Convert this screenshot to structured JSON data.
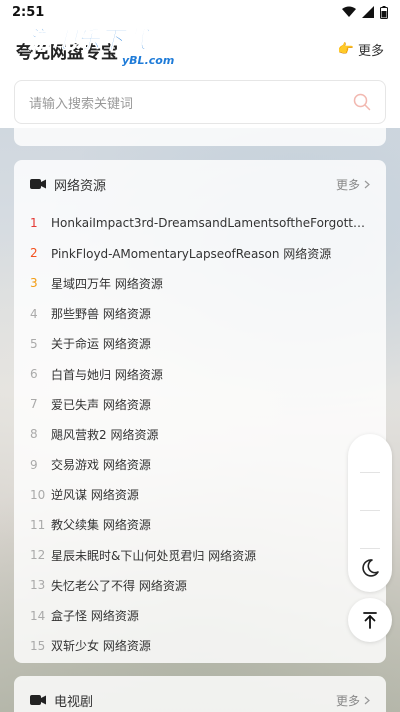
{
  "status_bar": {
    "time": "2:51"
  },
  "header": {
    "title": "夸克网盘专宝",
    "watermark": {
      "main": "游吧乐下载",
      "sub": "yBL.com"
    },
    "more_label": "更多",
    "more_emoji": "👉"
  },
  "search": {
    "placeholder": "请输入搜索关键词"
  },
  "section_network": {
    "title": "网络资源",
    "more_label": "更多",
    "items": [
      {
        "rank": "1",
        "text": "HonkaiImpact3rd-DreamsandLamentsoftheForgotte…"
      },
      {
        "rank": "2",
        "text": "PinkFloyd-AMomentaryLapseofReason 网络资源"
      },
      {
        "rank": "3",
        "text": "星域四万年 网络资源"
      },
      {
        "rank": "4",
        "text": "那些野兽 网络资源"
      },
      {
        "rank": "5",
        "text": "关于命运 网络资源"
      },
      {
        "rank": "6",
        "text": "白首与她归 网络资源"
      },
      {
        "rank": "7",
        "text": "爱已失声 网络资源"
      },
      {
        "rank": "8",
        "text": "飓风营救2 网络资源"
      },
      {
        "rank": "9",
        "text": "交易游戏 网络资源"
      },
      {
        "rank": "10",
        "text": "逆风谋 网络资源"
      },
      {
        "rank": "11",
        "text": "教父续集 网络资源"
      },
      {
        "rank": "12",
        "text": "星辰未眠时&下山何处觅君归 网络资源"
      },
      {
        "rank": "13",
        "text": "失忆老公了不得 网络资源"
      },
      {
        "rank": "14",
        "text": "盒子怪 网络资源"
      },
      {
        "rank": "15",
        "text": "双斩少女 网络资源"
      }
    ]
  },
  "section_tv": {
    "title": "电视剧",
    "more_label": "更多"
  },
  "colors": {
    "rank1": "#e53935",
    "rank2": "#f4511e",
    "rank3": "#f39c12",
    "search_icon": "#f2b8b0",
    "watermark": "#1e7bd8"
  }
}
